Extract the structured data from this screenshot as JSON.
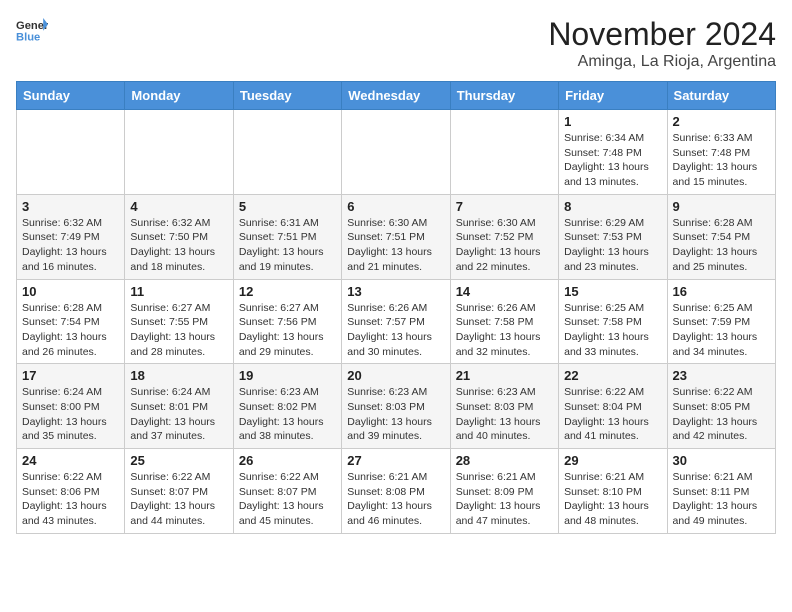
{
  "logo": {
    "line1": "General",
    "line2": "Blue"
  },
  "title": "November 2024",
  "subtitle": "Aminga, La Rioja, Argentina",
  "days_of_week": [
    "Sunday",
    "Monday",
    "Tuesday",
    "Wednesday",
    "Thursday",
    "Friday",
    "Saturday"
  ],
  "weeks": [
    [
      {
        "day": "",
        "info": ""
      },
      {
        "day": "",
        "info": ""
      },
      {
        "day": "",
        "info": ""
      },
      {
        "day": "",
        "info": ""
      },
      {
        "day": "",
        "info": ""
      },
      {
        "day": "1",
        "info": "Sunrise: 6:34 AM\nSunset: 7:48 PM\nDaylight: 13 hours\nand 13 minutes."
      },
      {
        "day": "2",
        "info": "Sunrise: 6:33 AM\nSunset: 7:48 PM\nDaylight: 13 hours\nand 15 minutes."
      }
    ],
    [
      {
        "day": "3",
        "info": "Sunrise: 6:32 AM\nSunset: 7:49 PM\nDaylight: 13 hours\nand 16 minutes."
      },
      {
        "day": "4",
        "info": "Sunrise: 6:32 AM\nSunset: 7:50 PM\nDaylight: 13 hours\nand 18 minutes."
      },
      {
        "day": "5",
        "info": "Sunrise: 6:31 AM\nSunset: 7:51 PM\nDaylight: 13 hours\nand 19 minutes."
      },
      {
        "day": "6",
        "info": "Sunrise: 6:30 AM\nSunset: 7:51 PM\nDaylight: 13 hours\nand 21 minutes."
      },
      {
        "day": "7",
        "info": "Sunrise: 6:30 AM\nSunset: 7:52 PM\nDaylight: 13 hours\nand 22 minutes."
      },
      {
        "day": "8",
        "info": "Sunrise: 6:29 AM\nSunset: 7:53 PM\nDaylight: 13 hours\nand 23 minutes."
      },
      {
        "day": "9",
        "info": "Sunrise: 6:28 AM\nSunset: 7:54 PM\nDaylight: 13 hours\nand 25 minutes."
      }
    ],
    [
      {
        "day": "10",
        "info": "Sunrise: 6:28 AM\nSunset: 7:54 PM\nDaylight: 13 hours\nand 26 minutes."
      },
      {
        "day": "11",
        "info": "Sunrise: 6:27 AM\nSunset: 7:55 PM\nDaylight: 13 hours\nand 28 minutes."
      },
      {
        "day": "12",
        "info": "Sunrise: 6:27 AM\nSunset: 7:56 PM\nDaylight: 13 hours\nand 29 minutes."
      },
      {
        "day": "13",
        "info": "Sunrise: 6:26 AM\nSunset: 7:57 PM\nDaylight: 13 hours\nand 30 minutes."
      },
      {
        "day": "14",
        "info": "Sunrise: 6:26 AM\nSunset: 7:58 PM\nDaylight: 13 hours\nand 32 minutes."
      },
      {
        "day": "15",
        "info": "Sunrise: 6:25 AM\nSunset: 7:58 PM\nDaylight: 13 hours\nand 33 minutes."
      },
      {
        "day": "16",
        "info": "Sunrise: 6:25 AM\nSunset: 7:59 PM\nDaylight: 13 hours\nand 34 minutes."
      }
    ],
    [
      {
        "day": "17",
        "info": "Sunrise: 6:24 AM\nSunset: 8:00 PM\nDaylight: 13 hours\nand 35 minutes."
      },
      {
        "day": "18",
        "info": "Sunrise: 6:24 AM\nSunset: 8:01 PM\nDaylight: 13 hours\nand 37 minutes."
      },
      {
        "day": "19",
        "info": "Sunrise: 6:23 AM\nSunset: 8:02 PM\nDaylight: 13 hours\nand 38 minutes."
      },
      {
        "day": "20",
        "info": "Sunrise: 6:23 AM\nSunset: 8:03 PM\nDaylight: 13 hours\nand 39 minutes."
      },
      {
        "day": "21",
        "info": "Sunrise: 6:23 AM\nSunset: 8:03 PM\nDaylight: 13 hours\nand 40 minutes."
      },
      {
        "day": "22",
        "info": "Sunrise: 6:22 AM\nSunset: 8:04 PM\nDaylight: 13 hours\nand 41 minutes."
      },
      {
        "day": "23",
        "info": "Sunrise: 6:22 AM\nSunset: 8:05 PM\nDaylight: 13 hours\nand 42 minutes."
      }
    ],
    [
      {
        "day": "24",
        "info": "Sunrise: 6:22 AM\nSunset: 8:06 PM\nDaylight: 13 hours\nand 43 minutes."
      },
      {
        "day": "25",
        "info": "Sunrise: 6:22 AM\nSunset: 8:07 PM\nDaylight: 13 hours\nand 44 minutes."
      },
      {
        "day": "26",
        "info": "Sunrise: 6:22 AM\nSunset: 8:07 PM\nDaylight: 13 hours\nand 45 minutes."
      },
      {
        "day": "27",
        "info": "Sunrise: 6:21 AM\nSunset: 8:08 PM\nDaylight: 13 hours\nand 46 minutes."
      },
      {
        "day": "28",
        "info": "Sunrise: 6:21 AM\nSunset: 8:09 PM\nDaylight: 13 hours\nand 47 minutes."
      },
      {
        "day": "29",
        "info": "Sunrise: 6:21 AM\nSunset: 8:10 PM\nDaylight: 13 hours\nand 48 minutes."
      },
      {
        "day": "30",
        "info": "Sunrise: 6:21 AM\nSunset: 8:11 PM\nDaylight: 13 hours\nand 49 minutes."
      }
    ]
  ]
}
